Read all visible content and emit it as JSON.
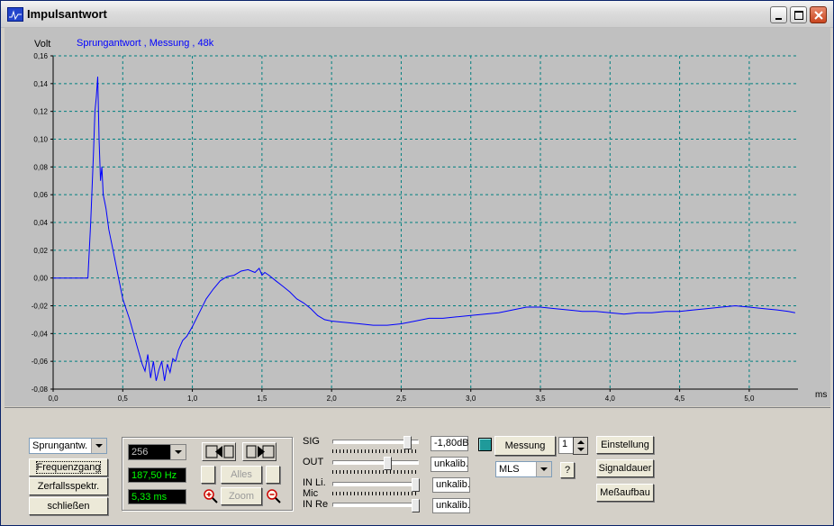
{
  "window": {
    "title": "Impulsantwort"
  },
  "chart_data": {
    "type": "line",
    "title": "Sprungantwort , Messung , 48k",
    "ylabel": "Volt",
    "xlabel": "ms",
    "xlim": [
      0,
      5.35
    ],
    "ylim": [
      -0.08,
      0.16
    ],
    "xticks": [
      0.0,
      0.5,
      1.0,
      1.5,
      2.0,
      2.5,
      3.0,
      3.5,
      4.0,
      4.5,
      5.0
    ],
    "xtick_labels": [
      "0,0",
      "0,5",
      "1,0",
      "1,5",
      "2,0",
      "2,5",
      "3,0",
      "3,5",
      "4,0",
      "4,5",
      "5,0"
    ],
    "yticks": [
      0.16,
      0.14,
      0.12,
      0.1,
      0.08,
      0.06,
      0.04,
      0.02,
      0.0,
      -0.02,
      -0.04,
      -0.06,
      -0.08
    ],
    "ytick_labels": [
      "0,16",
      "0,14",
      "0,12",
      "0,10",
      "0,08",
      "0,06",
      "0,04",
      "0,02",
      "0,00",
      "-0,02",
      "-0,04",
      "-0,06",
      "-0,08"
    ],
    "grid": true,
    "series": [
      {
        "color": "#0000ff",
        "x": [
          0.0,
          0.25,
          0.27,
          0.29,
          0.3,
          0.31,
          0.32,
          0.33,
          0.34,
          0.35,
          0.36,
          0.37,
          0.38,
          0.4,
          0.43,
          0.46,
          0.5,
          0.55,
          0.6,
          0.62,
          0.64,
          0.66,
          0.68,
          0.7,
          0.72,
          0.74,
          0.76,
          0.78,
          0.8,
          0.82,
          0.84,
          0.86,
          0.88,
          0.9,
          0.93,
          0.96,
          1.0,
          1.05,
          1.1,
          1.15,
          1.2,
          1.25,
          1.3,
          1.35,
          1.4,
          1.45,
          1.48,
          1.5,
          1.52,
          1.55,
          1.6,
          1.65,
          1.7,
          1.75,
          1.8,
          1.85,
          1.9,
          1.95,
          2.0,
          2.1,
          2.2,
          2.3,
          2.4,
          2.5,
          2.6,
          2.7,
          2.8,
          2.9,
          3.0,
          3.1,
          3.2,
          3.3,
          3.4,
          3.5,
          3.6,
          3.7,
          3.8,
          3.9,
          4.0,
          4.1,
          4.2,
          4.3,
          4.4,
          4.5,
          4.6,
          4.7,
          4.8,
          4.9,
          5.0,
          5.1,
          5.2,
          5.28,
          5.33
        ],
        "y": [
          0.0,
          0.0,
          0.04,
          0.09,
          0.12,
          0.13,
          0.145,
          0.1,
          0.07,
          0.08,
          0.06,
          0.055,
          0.05,
          0.035,
          0.02,
          0.005,
          -0.015,
          -0.03,
          -0.048,
          -0.055,
          -0.062,
          -0.067,
          -0.055,
          -0.072,
          -0.06,
          -0.074,
          -0.066,
          -0.06,
          -0.074,
          -0.062,
          -0.068,
          -0.058,
          -0.06,
          -0.052,
          -0.045,
          -0.042,
          -0.035,
          -0.025,
          -0.015,
          -0.008,
          -0.002,
          0.001,
          0.002,
          0.005,
          0.006,
          0.004,
          0.007,
          0.002,
          0.004,
          0.002,
          -0.002,
          -0.006,
          -0.01,
          -0.015,
          -0.018,
          -0.022,
          -0.027,
          -0.03,
          -0.031,
          -0.032,
          -0.033,
          -0.034,
          -0.034,
          -0.033,
          -0.031,
          -0.029,
          -0.029,
          -0.028,
          -0.027,
          -0.026,
          -0.025,
          -0.023,
          -0.021,
          -0.021,
          -0.022,
          -0.023,
          -0.024,
          -0.024,
          -0.025,
          -0.026,
          -0.025,
          -0.025,
          -0.024,
          -0.024,
          -0.023,
          -0.022,
          -0.021,
          -0.02,
          -0.021,
          -0.022,
          -0.023,
          -0.024,
          -0.025
        ]
      }
    ]
  },
  "controls": {
    "view_select": "Sprungantw.",
    "btn_frequenzgang": "Frequenzgang",
    "btn_zerfall": "Zerfallsspektr.",
    "btn_close": "schließen",
    "fft_size": "256",
    "freq_readout": "187,50 Hz",
    "time_readout": "5,33 ms",
    "btn_alles": "Alles",
    "btn_zoom": "Zoom",
    "sig_label": "SIG",
    "sig_value": "-1,80dB",
    "out_label": "OUT",
    "out_value": "unkalib.",
    "inli_label": "IN Li.",
    "inli_value": "unkalib.",
    "mic_label": "Mic",
    "inre_label": "IN Re",
    "inre_value": "unkalib.",
    "btn_messung": "Messung",
    "messung_count": "1",
    "signal_select": "MLS",
    "btn_help": "?",
    "btn_einstellung": "Einstellung",
    "btn_signaldauer": "Signaldauer",
    "btn_messaufbau": "Meßaufbau",
    "slider_levels": {
      "sig": 0.9,
      "out": 0.65,
      "inli": 1.0,
      "inre": 1.0
    }
  }
}
